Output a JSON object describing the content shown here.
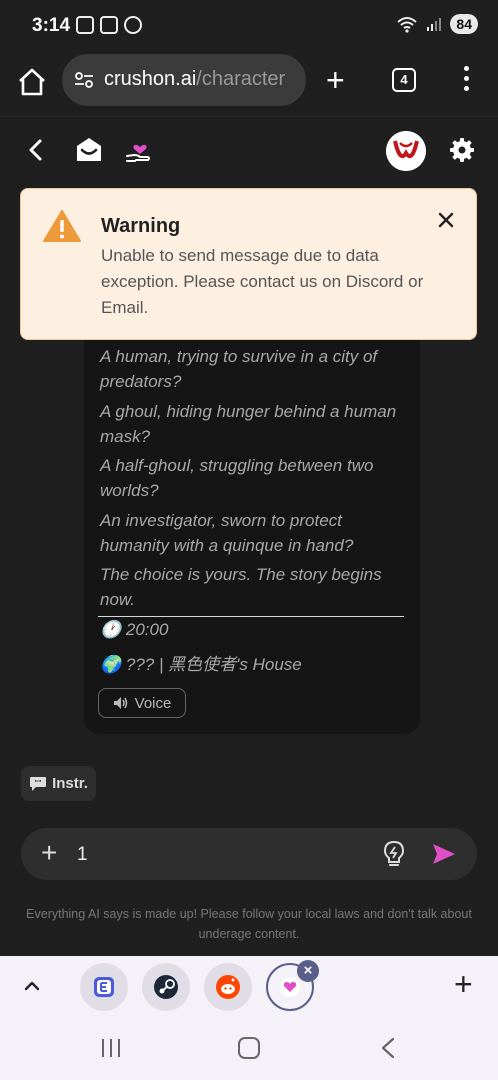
{
  "status_bar": {
    "time": "3:14",
    "battery": "84"
  },
  "browser": {
    "url_domain": "crushon.ai",
    "url_path": "/character",
    "tab_count": "4"
  },
  "message": {
    "lines": [
      "A human, trying to survive in a city of predators?",
      "A ghoul, hiding hunger behind a human mask?",
      "A half-ghoul, struggling between two worlds?",
      "An investigator, sworn to protect humanity with a quinque in hand?",
      "The choice is yours. The story begins now."
    ],
    "time": "🕐 20:00",
    "location": "🌍 ??? | 黑色使者's House",
    "voice_label": "Voice"
  },
  "warning": {
    "title": "Warning",
    "body": "Unable to send message due to data exception. Please contact us on Discord or Email."
  },
  "instr_label": "Instr.",
  "input": {
    "value": "1"
  },
  "disclaimer": "Everything AI says is made up! Please follow your local laws and don't talk about underage content.",
  "colors": {
    "accent": "#e04fc8",
    "warning_bg": "#fdf0e0",
    "warning_icon": "#ef9a3a"
  }
}
